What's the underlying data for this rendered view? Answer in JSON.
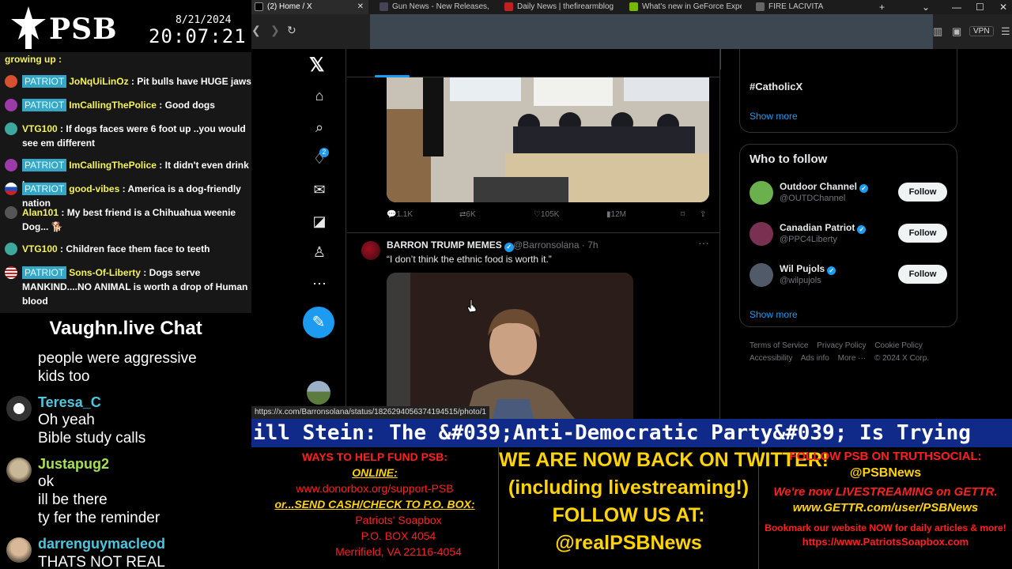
{
  "overlay": {
    "logo": "PSB",
    "date": "8/21/2024",
    "time": "20:07:21",
    "chat_top": [
      {
        "tag": "",
        "user": "",
        "text": "growing up :",
        "avatar": ""
      },
      {
        "tag": "PATRIOT",
        "user": "JoNqUiLinOz",
        "text": "Pit bulls have HUGE jaws",
        "avatar": "#d85030"
      },
      {
        "tag": "PATRIOT",
        "user": "ImCallingThePolice",
        "text": "Good dogs",
        "avatar": "#9b3aa8"
      },
      {
        "tag": "",
        "user": "VTG100",
        "text": "If dogs faces were 6 foot up ..you would see em different",
        "avatar": "#3da89b"
      },
      {
        "tag": "PATRIOT",
        "user": "ImCallingThePolice",
        "text": "It didn't even drink .",
        "avatar": "#9b3aa8"
      },
      {
        "tag": "PATRIOT",
        "user": "good-vibes",
        "text": "America is a dog-friendly nation",
        "avatar": "#d02020"
      },
      {
        "tag": "",
        "user": "Alan101",
        "text": "My best friend is a Chihuahua weenie Dog... 🐕",
        "avatar": "#555"
      },
      {
        "tag": "",
        "user": "VTG100",
        "text": "Children face them face to teeth",
        "avatar": "#3da89b"
      },
      {
        "tag": "PATRIOT",
        "user": "Sons-Of-Liberty",
        "text": "Dogs serve MANKIND....NO ANIMAL is worth a drop of Human blood",
        "avatar": "#3050b0"
      }
    ],
    "vaughn_title": "Vaughn.live Chat",
    "vaughn_lines": [
      {
        "user": "",
        "text": "people were aggressive"
      },
      {
        "user": "",
        "text": "kids too"
      },
      {
        "user": "Teresa_C",
        "text": ""
      },
      {
        "user": "",
        "text": "Oh yeah"
      },
      {
        "user": "",
        "text": "Bible study calls"
      },
      {
        "user": "Justapug2",
        "text": ""
      },
      {
        "user": "",
        "text": "ok"
      },
      {
        "user": "",
        "text": "ill be there"
      },
      {
        "user": "",
        "text": "ty fer the reminder"
      },
      {
        "user": "darrenguymacleod",
        "text": ""
      },
      {
        "user": "",
        "text": "THATS NOT REAL"
      }
    ]
  },
  "browser": {
    "tabs": [
      {
        "label": "(2) Home / X",
        "active": true,
        "color": "#000"
      },
      {
        "label": "Gun News - New Releases, A",
        "active": false,
        "color": "#445"
      },
      {
        "label": "Daily News | thefirearmblog",
        "active": false,
        "color": "#c02020"
      },
      {
        "label": "What's new in GeForce Expe",
        "active": false,
        "color": "#76b900"
      },
      {
        "label": "FIRE LACIVITA",
        "active": false,
        "color": "#666"
      }
    ],
    "vpn_label": "VPN",
    "status_url": "https://x.com/Barronsolana/status/1826294056374194515/photo/1"
  },
  "x": {
    "notif_count": "2",
    "post1_stats": {
      "replies": "1.1K",
      "reposts": "6K",
      "likes": "105K",
      "views": "12M"
    },
    "post2": {
      "name": "BARRON TRUMP MEMES",
      "handle": "@Barronsolana · 7h",
      "text": "“I don’t think the ethnic food is worth it.”"
    },
    "trend_tag": "#CatholicX",
    "show_more": "Show more",
    "who_to_follow_title": "Who to follow",
    "follow_label": "Follow",
    "who_to_follow": [
      {
        "name": "Outdoor Channel",
        "handle": "@OUTDChannel",
        "color": "#6ab04c"
      },
      {
        "name": "Canadian Patriot",
        "handle": "@PPC4Liberty",
        "color": "#7a3050"
      },
      {
        "name": "Wil Pujols",
        "handle": "@wilpujols",
        "color": "#505a68"
      }
    ],
    "footer": [
      "Terms of Service",
      "Privacy Policy",
      "Cookie Policy",
      "Accessibility",
      "Ads info",
      "More ···",
      "© 2024 X Corp."
    ]
  },
  "banner": {
    "ticker": "ill Stein: The &#039;Anti-Democratic Party&#039; Is Trying",
    "col1": [
      "WAYS TO HELP FUND PSB:",
      "ONLINE:",
      "www.donorbox.org/support-PSB",
      "or...SEND CASH/CHECK TO P.O. BOX:",
      "Patriots' Soapbox",
      "P.O. BOX 4054",
      "Merrifield, VA 22116-4054"
    ],
    "col2": [
      "WE ARE NOW BACK ON TWITTER!",
      "(including livestreaming!)",
      "FOLLOW US AT:",
      "@realPSBNews"
    ],
    "col3": [
      "FOLLOW PSB ON TRUTHSOCIAL:",
      "@PSBNews",
      "We're now LIVESTREAMING on GETTR.",
      "www.GETTR.com/user/PSBNews",
      "Bookmark our website NOW for daily articles & more!",
      "https://www.PatriotsSoapbox.com"
    ]
  }
}
